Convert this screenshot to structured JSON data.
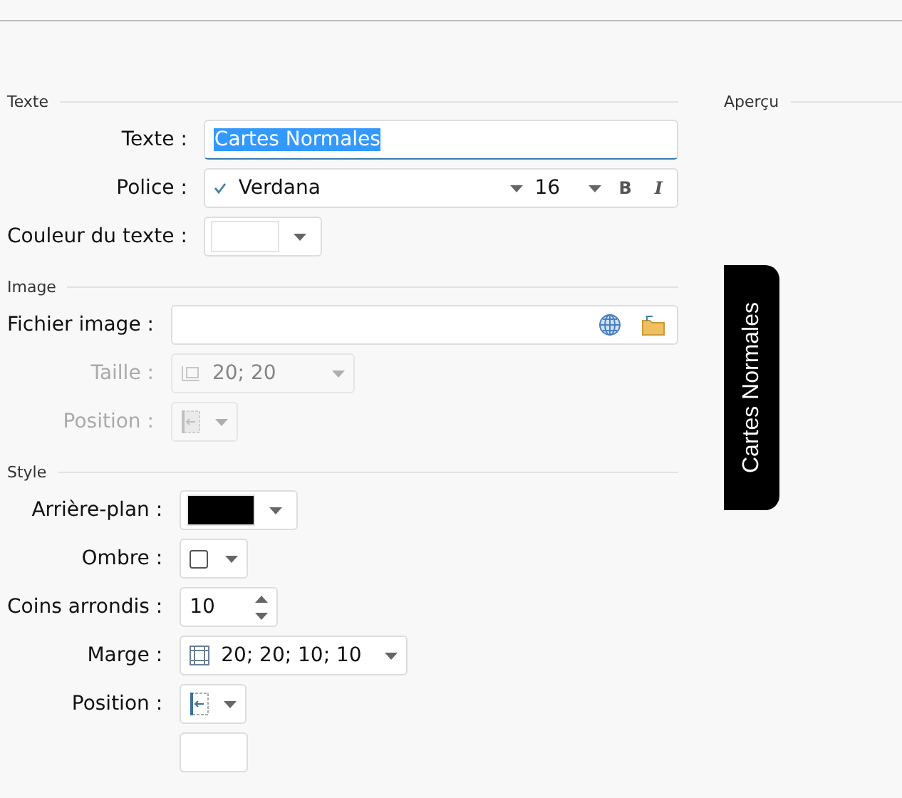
{
  "sections": [
    {
      "title": "Texte",
      "rows": [
        {
          "kind": "text",
          "label": "Texte :",
          "value": "Cartes Normales",
          "text_selected": true,
          "disabled": false
        },
        {
          "kind": "font",
          "label": "Police :",
          "value": "Verdana",
          "size": "16",
          "bold": {
            "label": "B",
            "on": false
          },
          "italic": {
            "label": "I",
            "on": false
          },
          "disabled": false
        },
        {
          "kind": "color",
          "label": "Couleur du texte :",
          "color": "#ffffff",
          "disabled": false
        }
      ]
    },
    {
      "title": "Image",
      "rows": [
        {
          "kind": "file",
          "label": "Fichier image :",
          "disabled": false
        },
        {
          "kind": "size",
          "label": "Taille :",
          "value": "20; 20",
          "disabled": true
        },
        {
          "kind": "position",
          "label": "Position :",
          "disabled": true
        }
      ]
    },
    {
      "title": "Style",
      "rows": [
        {
          "kind": "color",
          "label": "Arrière-plan :",
          "color": "#000000",
          "disabled": false
        },
        {
          "kind": "shadow",
          "label": "Ombre :",
          "checked": false,
          "disabled": false
        },
        {
          "kind": "spin",
          "label": "Coins arrondis :",
          "value": "10",
          "disabled": false
        },
        {
          "kind": "margin",
          "label": "Marge :",
          "value": "20; 20; 10; 10",
          "disabled": false
        },
        {
          "kind": "position",
          "label": "Position :",
          "disabled": false
        },
        {
          "kind": "partial"
        }
      ]
    }
  ],
  "preview": {
    "title": "Aperçu",
    "card_text": "Cartes Normales"
  }
}
